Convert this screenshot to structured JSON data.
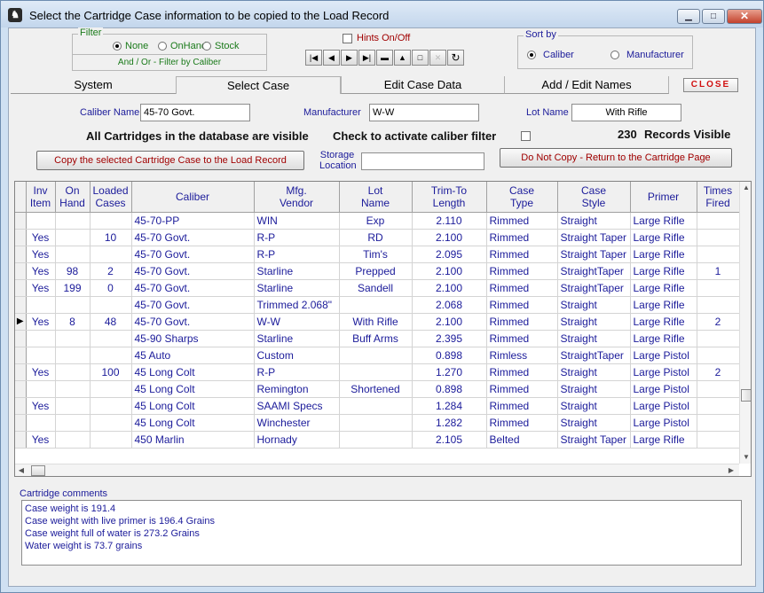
{
  "window": {
    "title": "Select the Cartridge Case information to be copied to the Load Record",
    "controls": {
      "minimize": "▁",
      "maximize": "□",
      "close": "✕"
    }
  },
  "filter": {
    "legend": "Filter",
    "options": [
      "None",
      "OnHand",
      "Stock"
    ],
    "selected": "None",
    "note": "And / Or - Filter by Caliber"
  },
  "hints": {
    "label": "Hints On/Off",
    "checked": false
  },
  "navigator": [
    "first",
    "prior",
    "next",
    "last",
    "delete",
    "insert",
    "edit",
    "cancel",
    "refresh"
  ],
  "sort": {
    "legend": "Sort by",
    "options": [
      "Caliber",
      "Manufacturer"
    ],
    "selected": "Caliber"
  },
  "tabs": [
    "System",
    "Select Case",
    "Edit Case Data",
    "Add / Edit Names"
  ],
  "active_tab": "Select Case",
  "close_label": "CLOSE",
  "form": {
    "caliber_label": "Caliber Name",
    "caliber_value": "45-70 Govt.",
    "manufacturer_label": "Manufacturer",
    "manufacturer_value": "W-W",
    "lot_label": "Lot Name",
    "lot_value": "With Rifle",
    "visible_msg": "All Cartridges in the database are visible",
    "filter_check_label": "Check to activate caliber filter",
    "records_count": "230",
    "records_label": "Records Visible",
    "copy_button": "Copy the selected Cartridge Case to the Load Record",
    "storage_label_1": "Storage",
    "storage_label_2": "Location",
    "storage_value": "",
    "no_copy_button": "Do Not Copy - Return to the Cartridge Page"
  },
  "grid": {
    "headers": [
      [
        "Inv",
        "Item"
      ],
      [
        "On",
        "Hand"
      ],
      [
        "Loaded",
        "Cases"
      ],
      [
        "Caliber",
        ""
      ],
      [
        "Mfg.",
        "Vendor"
      ],
      [
        "Lot",
        "Name"
      ],
      [
        "Trim-To",
        "Length"
      ],
      [
        "Case",
        "Type"
      ],
      [
        "Case",
        "Style"
      ],
      [
        "Primer",
        ""
      ],
      [
        "Times",
        "Fired"
      ]
    ],
    "selected_row": 6,
    "rows": [
      [
        "",
        "",
        "",
        "45-70-PP",
        "WIN",
        "Exp",
        "2.110",
        "Rimmed",
        "Straight",
        "Large Rifle",
        ""
      ],
      [
        "Yes",
        "",
        "10",
        "45-70 Govt.",
        "R-P",
        "RD",
        "2.100",
        "Rimmed",
        "Straight Taper",
        "Large Rifle",
        ""
      ],
      [
        "Yes",
        "",
        "",
        "45-70 Govt.",
        "R-P",
        "Tim's",
        "2.095",
        "Rimmed",
        "Straight Taper",
        "Large Rifle",
        ""
      ],
      [
        "Yes",
        "98",
        "2",
        "45-70 Govt.",
        "Starline",
        "Prepped",
        "2.100",
        "Rimmed",
        "StraightTaper",
        "Large Rifle",
        "1"
      ],
      [
        "Yes",
        "199",
        "0",
        "45-70 Govt.",
        "Starline",
        "Sandell",
        "2.100",
        "Rimmed",
        "StraightTaper",
        "Large Rifle",
        ""
      ],
      [
        "",
        "",
        "",
        "45-70 Govt.",
        "Trimmed 2.068\"",
        "",
        "2.068",
        "Rimmed",
        "Straight",
        "Large Rifle",
        ""
      ],
      [
        "Yes",
        "8",
        "48",
        "45-70 Govt.",
        "W-W",
        "With Rifle",
        "2.100",
        "Rimmed",
        "Straight",
        "Large Rifle",
        "2"
      ],
      [
        "",
        "",
        "",
        "45-90 Sharps",
        "Starline",
        "Buff Arms",
        "2.395",
        "Rimmed",
        "Straight",
        "Large Rifle",
        ""
      ],
      [
        "",
        "",
        "",
        "45 Auto",
        "Custom",
        "",
        "0.898",
        "Rimless",
        "StraightTaper",
        "Large Pistol",
        ""
      ],
      [
        "Yes",
        "",
        "100",
        "45 Long Colt",
        "R-P",
        "",
        "1.270",
        "Rimmed",
        "Straight",
        "Large Pistol",
        "2"
      ],
      [
        "",
        "",
        "",
        "45 Long Colt",
        "Remington",
        "Shortened",
        "0.898",
        "Rimmed",
        "Straight",
        "Large Pistol",
        ""
      ],
      [
        "Yes",
        "",
        "",
        "45 Long Colt",
        "SAAMI Specs",
        "",
        "1.284",
        "Rimmed",
        "Straight",
        "Large Pistol",
        ""
      ],
      [
        "",
        "",
        "",
        "45 Long Colt",
        "Winchester",
        "",
        "1.282",
        "Rimmed",
        "Straight",
        "Large Pistol",
        ""
      ],
      [
        "Yes",
        "",
        "",
        "450 Marlin",
        "Hornady",
        "",
        "2.105",
        "Belted",
        "Straight Taper",
        "Large Rifle",
        ""
      ]
    ]
  },
  "comments": {
    "label": "Cartridge comments",
    "lines": [
      "Case weight is 191.4",
      "Case weight with live primer is 196.4 Grains",
      "Case weight full of water is 273.2 Grains",
      "Water weight is 73.7 grains"
    ]
  },
  "colors": {
    "data_text": "#1b1b9a",
    "button_text": "#a00000",
    "close_text": "#d01010"
  }
}
